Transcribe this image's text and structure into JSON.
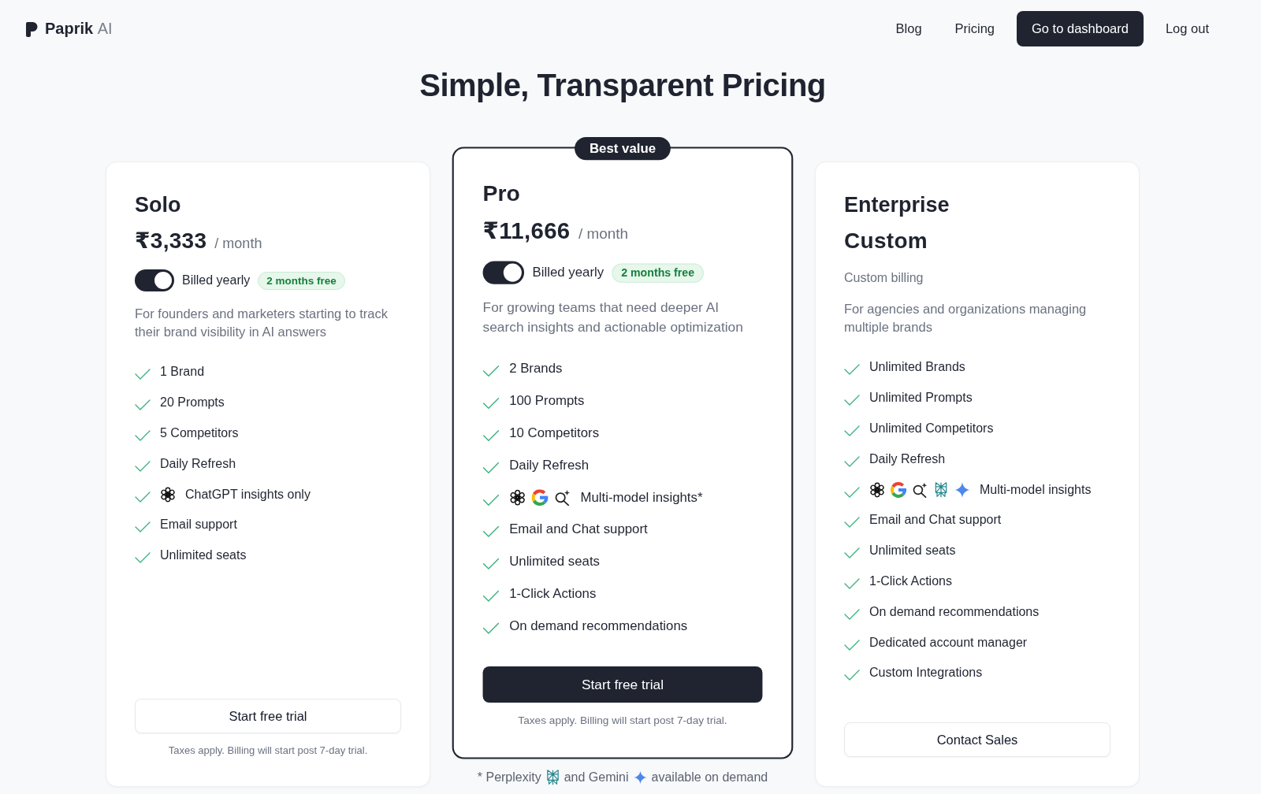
{
  "header": {
    "brand": {
      "name": "Paprik",
      "suffix": "AI"
    },
    "nav": [
      {
        "label": "Blog",
        "kind": "link"
      },
      {
        "label": "Pricing",
        "kind": "link"
      },
      {
        "label": "Go to dashboard",
        "kind": "button"
      },
      {
        "label": "Log out",
        "kind": "link"
      }
    ]
  },
  "title": "Simple, Transparent Pricing",
  "plans": [
    {
      "name": "Solo",
      "featured": false,
      "price": "₹3,333",
      "period": "/ month",
      "billing": {
        "on": true,
        "label": "Billed yearly",
        "tag": "2 months free"
      },
      "description": "For founders and marketers starting to track their brand visibility in AI answers",
      "features": [
        {
          "text": "1 Brand"
        },
        {
          "text": "20 Prompts"
        },
        {
          "text": "5 Competitors"
        },
        {
          "text": "Daily Refresh"
        },
        {
          "text": "ChatGPT insights only",
          "icons": [
            {
              "kind": "knot"
            }
          ]
        },
        {
          "text": "Email support"
        },
        {
          "text": "Unlimited seats"
        }
      ],
      "cta": {
        "label": "Start free trial",
        "kind": "outline"
      },
      "note": "Taxes apply. Billing will start post 7-day trial."
    },
    {
      "name": "Pro",
      "featured": true,
      "ribbon": "Best value",
      "price": "₹11,666",
      "period": "/ month",
      "billing": {
        "on": true,
        "label": "Billed yearly",
        "tag": "2 months free"
      },
      "description": "For growing teams that need deeper AI search insights and actionable optimization",
      "features": [
        {
          "text": "2 Brands"
        },
        {
          "text": "100 Prompts"
        },
        {
          "text": "10 Competitors"
        },
        {
          "text": "Daily Refresh"
        },
        {
          "text": "Multi-model insights*",
          "icons": [
            {
              "kind": "knot"
            },
            {
              "kind": "letterg"
            },
            {
              "kind": "sparklesearch"
            }
          ]
        },
        {
          "text": "Email and Chat support"
        },
        {
          "text": "Unlimited seats"
        },
        {
          "text": "1-Click Actions"
        },
        {
          "text": "On demand recommendations"
        }
      ],
      "cta": {
        "label": "Start free trial",
        "kind": "primary"
      },
      "note": "Taxes apply. Billing will start post 7-day trial.",
      "footnote": [
        {
          "kind": "text",
          "text": "* Perplexity"
        },
        {
          "kind": "lattice"
        },
        {
          "kind": "text",
          "text": "and Gemini"
        },
        {
          "kind": "sparkle"
        },
        {
          "kind": "text",
          "text": "available on demand"
        }
      ]
    },
    {
      "name": "Enterprise",
      "featured": false,
      "price": "Custom",
      "subtitle": "Custom billing",
      "description": "For agencies and organizations managing multiple brands",
      "features": [
        {
          "text": "Unlimited Brands"
        },
        {
          "text": "Unlimited Prompts"
        },
        {
          "text": "Unlimited Competitors"
        },
        {
          "text": "Daily Refresh"
        },
        {
          "text": "Multi-model insights",
          "icons": [
            {
              "kind": "knot"
            },
            {
              "kind": "letterg"
            },
            {
              "kind": "sparklesearch"
            },
            {
              "kind": "lattice"
            },
            {
              "kind": "sparkle"
            }
          ]
        },
        {
          "text": "Email and Chat support"
        },
        {
          "text": "Unlimited seats"
        },
        {
          "text": "1-Click Actions"
        },
        {
          "text": "On demand recommendations"
        },
        {
          "text": "Dedicated account manager"
        },
        {
          "text": "Custom Integrations"
        }
      ],
      "cta": {
        "label": "Contact Sales",
        "kind": "outline"
      }
    }
  ]
}
